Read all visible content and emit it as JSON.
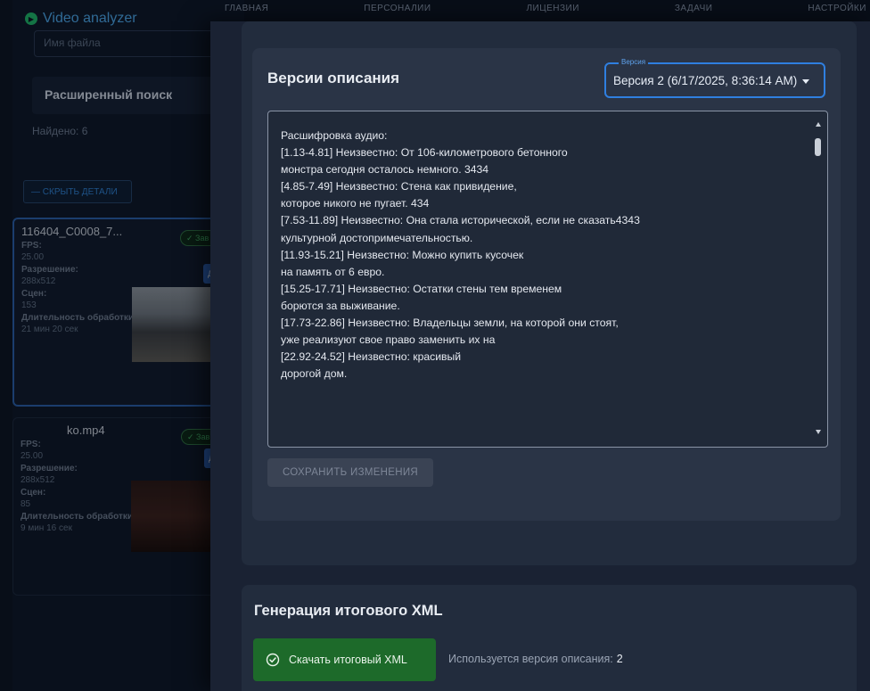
{
  "app": {
    "brand": "Video analyzer",
    "file_field_placeholder": "Имя файла",
    "advanced_search_label": "Расширенный поиск",
    "found_text": "Найдено: 6",
    "hide_details_label": "— СКРЫТЬ ДЕТАЛИ",
    "nav": [
      "ГЛАВНАЯ",
      "ПЕРСОНАЛИИ",
      "ЛИЦЕНЗИИ",
      "ЗАДАЧИ",
      "НАСТРОЙКИ"
    ]
  },
  "cards": [
    {
      "title": "116404_C0008_7...",
      "status": "✓ Зав",
      "fps_label": "FPS:",
      "fps": "25.00",
      "res_label": "Разрешение:",
      "resolution": "288x512",
      "scenes_label": "Сцен:",
      "scenes": "153",
      "duration_label": "Длительность обработки:",
      "duration": "21 мин 20 сек"
    },
    {
      "title": "ko.mp4",
      "status": "✓ Зав",
      "fps_label": "FPS:",
      "fps": "25.00",
      "res_label": "Разрешение:",
      "resolution": "288x512",
      "scenes_label": "Сцен:",
      "scenes": "85",
      "duration_label": "Длительность обработки:",
      "duration": "9 мин 16 сек"
    }
  ],
  "versions": {
    "title": "Версии описания",
    "select_legend": "Версия",
    "selected": "Версия 2 (6/17/2025, 8:36:14 AM)",
    "description": "Расшифровка аудио:\n[1.13-4.81] Неизвестно: От 106-километрового бетонного\nмонстра сегодня осталось немного. 3434\n[4.85-7.49] Неизвестно: Стена как привидение,\nкоторое никого не пугает. 434\n[7.53-11.89] Неизвестно: Она стала исторической, если не сказать4343\nкультурной достопримечательностью.\n[11.93-15.21] Неизвестно: Можно купить кусочек\nна память от 6 евро.\n[15.25-17.71] Неизвестно: Остатки стены тем временем\nборются за выживание.\n[17.73-22.86] Неизвестно: Владельцы земли, на которой они стоят,\nуже реализуют свое право заменить их на\n[22.92-24.52] Неизвестно: красивый\nдорогой дом.",
    "save_label": "СОХРАНИТЬ ИЗМЕНЕНИЯ"
  },
  "xml": {
    "title": "Генерация итогового XML",
    "download_label": "Скачать итоговый XML",
    "note_label": "Используется версия описания:",
    "version_number": "2"
  },
  "colors": {
    "accent_blue": "#2f7fe0",
    "success_green": "#1d6a2a"
  }
}
